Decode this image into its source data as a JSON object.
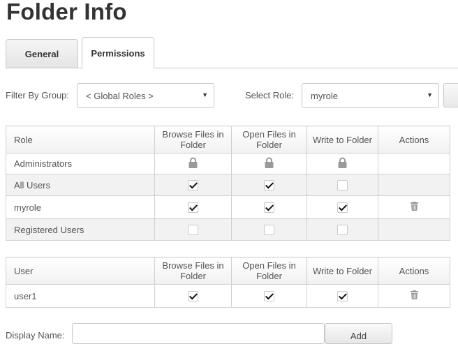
{
  "page_title": "Folder Info",
  "tabs": [
    {
      "label": "General",
      "active": false
    },
    {
      "label": "Permissions",
      "active": true
    }
  ],
  "filter": {
    "group_label": "Filter By Group:",
    "group_value": "< Global Roles >",
    "role_label": "Select Role:",
    "role_value": "myrole"
  },
  "role_table": {
    "headers": [
      "Role",
      "Browse Files in Folder",
      "Open Files in Folder",
      "Write to Folder",
      "Actions"
    ],
    "rows": [
      {
        "name": "Administrators",
        "browse": "locked",
        "open": "locked",
        "write": "locked",
        "delete": false
      },
      {
        "name": "All Users",
        "browse": "checked",
        "open": "checked",
        "write": "unchecked",
        "delete": false
      },
      {
        "name": "myrole",
        "browse": "checked",
        "open": "checked",
        "write": "checked",
        "delete": true
      },
      {
        "name": "Registered Users",
        "browse": "unchecked",
        "open": "unchecked",
        "write": "unchecked",
        "delete": false
      }
    ]
  },
  "user_table": {
    "headers": [
      "User",
      "Browse Files in Folder",
      "Open Files in Folder",
      "Write to Folder",
      "Actions"
    ],
    "rows": [
      {
        "name": "user1",
        "browse": "checked",
        "open": "checked",
        "write": "checked",
        "delete": true
      }
    ]
  },
  "add_form": {
    "display_name_label": "Display Name:",
    "add_label": "Add"
  },
  "icons": {
    "lock": "lock-icon",
    "delete": "trash-icon",
    "dropdown": "caret-down-icon"
  },
  "colors": {
    "checkmark": "#111111",
    "border": "#cfcfcf",
    "alt_row": "#f2f2f2"
  }
}
